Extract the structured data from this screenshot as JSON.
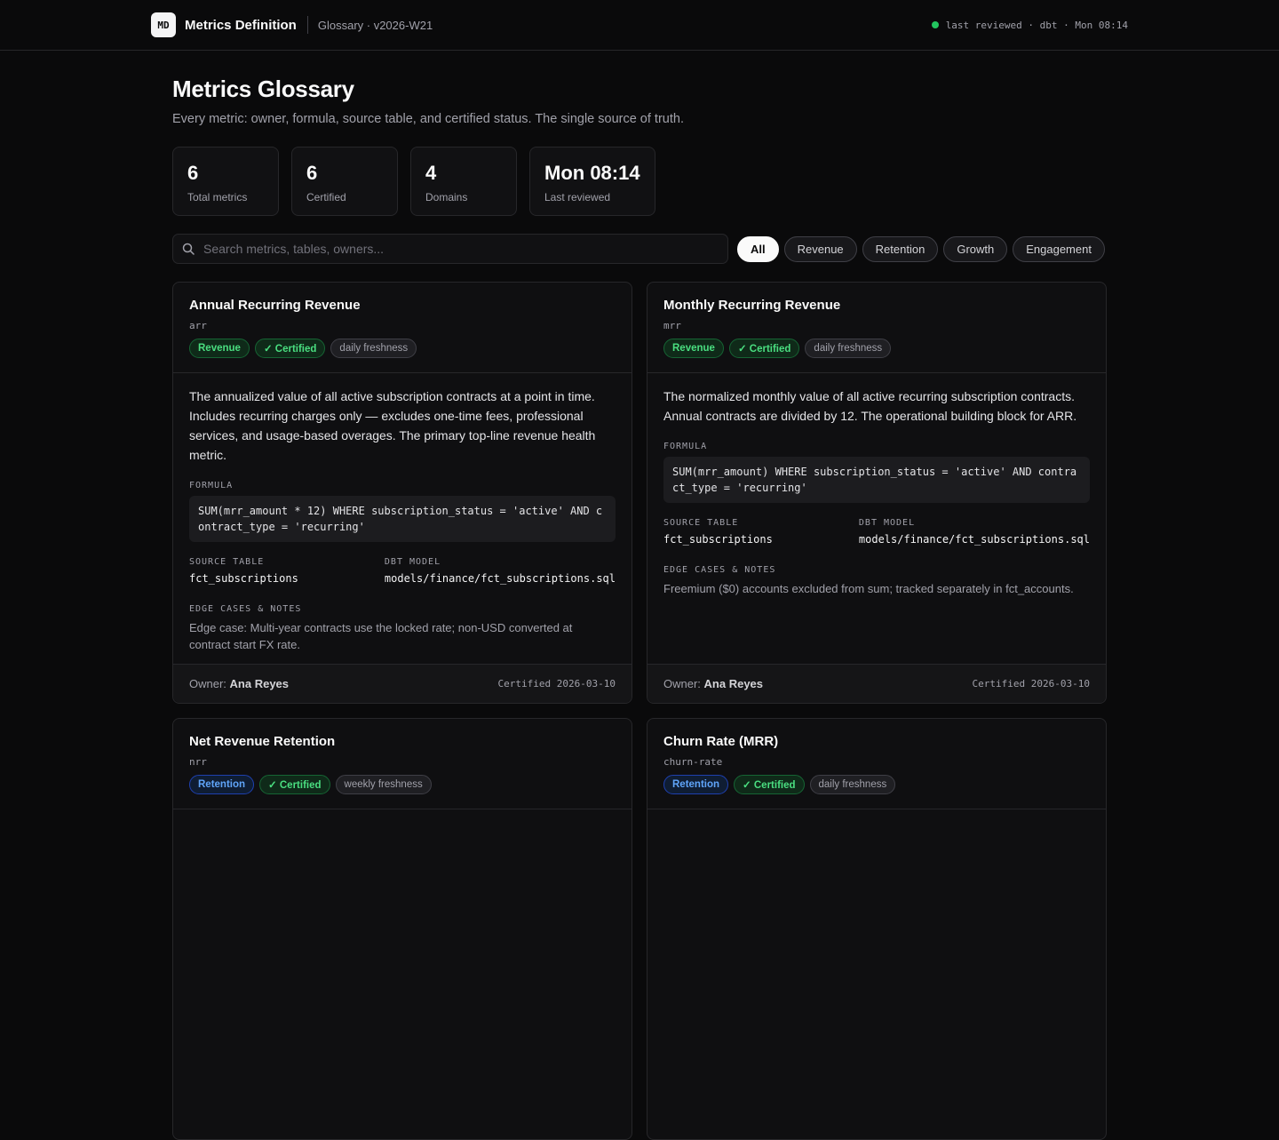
{
  "app": {
    "logo_text": "MD",
    "title": "Metrics Definition",
    "breadcrumb": "Glossary · v2026-W21",
    "status_text": "last reviewed · dbt · Mon 08:14",
    "status_color": "#22c55e"
  },
  "page": {
    "title": "Metrics Glossary",
    "subtitle": "Every metric: owner, formula, source table, and certified status. The single source of truth."
  },
  "stats": [
    {
      "value": "6",
      "label": "Total metrics"
    },
    {
      "value": "6",
      "label": "Certified"
    },
    {
      "value": "4",
      "label": "Domains"
    },
    {
      "value": "Mon 08:14",
      "label": "Last reviewed"
    }
  ],
  "search": {
    "placeholder": "Search metrics, tables, owners...",
    "icon": "search-icon"
  },
  "filters": [
    {
      "label": "All",
      "active": true
    },
    {
      "label": "Revenue",
      "active": false
    },
    {
      "label": "Retention",
      "active": false
    },
    {
      "label": "Growth",
      "active": false
    },
    {
      "label": "Engagement",
      "active": false
    }
  ],
  "labels": {
    "formula": "FORMULA",
    "source_table": "SOURCE TABLE",
    "dbt_model": "DBT MODEL",
    "notes": "EDGE CASES & NOTES",
    "owner_prefix": "Owner:"
  },
  "metrics": [
    {
      "name": "Annual Recurring Revenue",
      "key": "arr",
      "domain": "Revenue",
      "certified": "✓ Certified",
      "freshness": "daily freshness",
      "description": "The annualized value of all active subscription contracts at a point in time. Includes recurring charges only — excludes one-time fees, professional services, and usage-based overages. The primary top-line revenue health metric.",
      "formula": "SUM(mrr_amount * 12) WHERE subscription_status = 'active' AND contract_type = 'recurring'",
      "source_table": "fct_subscriptions",
      "dbt_model": "models/finance/fct_subscriptions.sql",
      "notes": "Edge case: Multi-year contracts use the locked rate; non-USD converted at contract start FX rate.",
      "owner": "Ana Reyes",
      "certified_date": "Certified 2026-03-10"
    },
    {
      "name": "Monthly Recurring Revenue",
      "key": "mrr",
      "domain": "Revenue",
      "certified": "✓ Certified",
      "freshness": "daily freshness",
      "description": "The normalized monthly value of all active recurring subscription contracts. Annual contracts are divided by 12. The operational building block for ARR.",
      "formula": "SUM(mrr_amount) WHERE subscription_status = 'active' AND contract_type = 'recurring'",
      "source_table": "fct_subscriptions",
      "dbt_model": "models/finance/fct_subscriptions.sql",
      "notes": "Freemium ($0) accounts excluded from sum; tracked separately in fct_accounts.",
      "owner": "Ana Reyes",
      "certified_date": "Certified 2026-03-10"
    },
    {
      "name": "Net Revenue Retention",
      "key": "nrr",
      "domain": "Retention",
      "certified": "✓ Certified",
      "freshness": "weekly freshness"
    },
    {
      "name": "Churn Rate (MRR)",
      "key": "churn-rate",
      "domain": "Retention",
      "certified": "✓ Certified",
      "freshness": "daily freshness"
    }
  ]
}
